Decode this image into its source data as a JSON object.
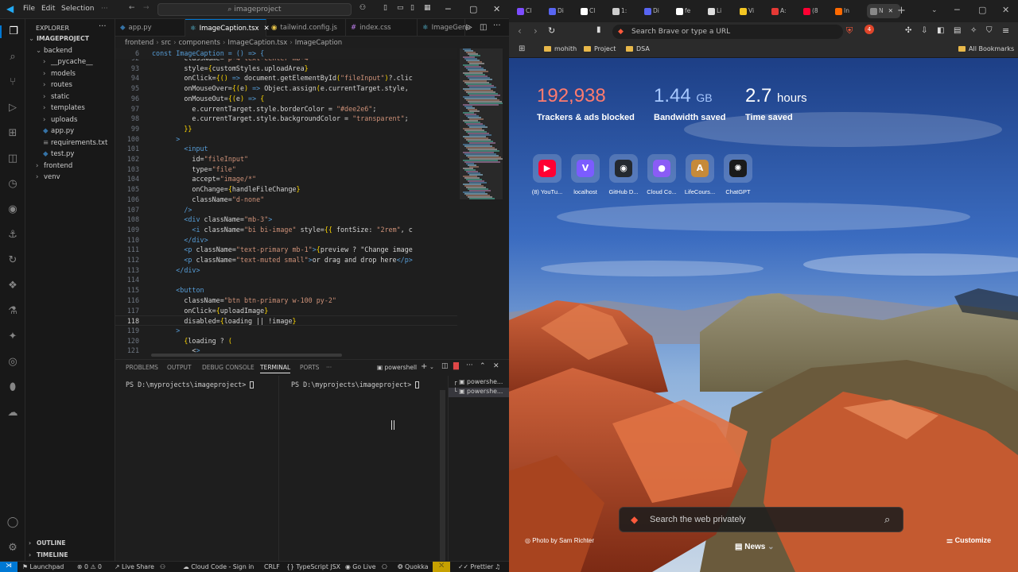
{
  "vscode": {
    "menu": [
      "File",
      "Edit",
      "Selection"
    ],
    "search_text": "imageproject",
    "explorer_title": "EXPLORER",
    "tree": [
      {
        "label": "IMAGEPROJECT",
        "depth": 0,
        "kind": "root"
      },
      {
        "label": "backend",
        "depth": 1,
        "kind": "folder-open"
      },
      {
        "label": "__pycache__",
        "depth": 2,
        "kind": "folder"
      },
      {
        "label": "models",
        "depth": 2,
        "kind": "folder"
      },
      {
        "label": "routes",
        "depth": 2,
        "kind": "folder"
      },
      {
        "label": "static",
        "depth": 2,
        "kind": "folder"
      },
      {
        "label": "templates",
        "depth": 2,
        "kind": "folder"
      },
      {
        "label": "uploads",
        "depth": 2,
        "kind": "folder"
      },
      {
        "label": "app.py",
        "depth": 2,
        "kind": "py"
      },
      {
        "label": "requirements.txt",
        "depth": 2,
        "kind": "txt"
      },
      {
        "label": "test.py",
        "depth": 2,
        "kind": "py"
      },
      {
        "label": "frontend",
        "depth": 1,
        "kind": "folder"
      },
      {
        "label": "venv",
        "depth": 1,
        "kind": "folder"
      }
    ],
    "outline_label": "OUTLINE",
    "timeline_label": "TIMELINE",
    "tabs": [
      {
        "label": "app.py",
        "active": false
      },
      {
        "label": "ImageCaption.tsx",
        "active": true
      },
      {
        "label": "tailwind.config.js",
        "active": false
      },
      {
        "label": "index.css",
        "active": false
      },
      {
        "label": "ImageGene",
        "active": false
      }
    ],
    "breadcrumb": [
      "frontend",
      "src",
      "components",
      "ImageCaption.tsx",
      "ImageCaption"
    ],
    "sticky_line": {
      "num": "6",
      "text": "const ImageCaption = () => {"
    },
    "code": [
      {
        "num": "92",
        "text": "        className=\"p-4 text-center mb-4\""
      },
      {
        "num": "93",
        "text": "        style={customStyles.uploadArea}"
      },
      {
        "num": "94",
        "text": "        onClick={() => document.getElementById(\"fileInput\")?.clic"
      },
      {
        "num": "95",
        "text": "        onMouseOver={(e) => Object.assign(e.currentTarget.style,"
      },
      {
        "num": "96",
        "text": "        onMouseOut={(e) => {"
      },
      {
        "num": "97",
        "text": "          e.currentTarget.style.borderColor = \"#dee2e6\";"
      },
      {
        "num": "98",
        "text": "          e.currentTarget.style.backgroundColor = \"transparent\";"
      },
      {
        "num": "99",
        "text": "        }}"
      },
      {
        "num": "100",
        "text": "      >"
      },
      {
        "num": "101",
        "text": "        <input"
      },
      {
        "num": "102",
        "text": "          id=\"fileInput\""
      },
      {
        "num": "103",
        "text": "          type=\"file\""
      },
      {
        "num": "104",
        "text": "          accept=\"image/*\""
      },
      {
        "num": "105",
        "text": "          onChange={handleFileChange}"
      },
      {
        "num": "106",
        "text": "          className=\"d-none\""
      },
      {
        "num": "107",
        "text": "        />"
      },
      {
        "num": "108",
        "text": "        <div className=\"mb-3\">"
      },
      {
        "num": "109",
        "text": "          <i className=\"bi bi-image\" style={{ fontSize: \"2rem\", c"
      },
      {
        "num": "110",
        "text": "        </div>"
      },
      {
        "num": "111",
        "text": "        <p className=\"text-primary mb-1\">{preview ? \"Change image"
      },
      {
        "num": "112",
        "text": "        <p className=\"text-muted small\">or drag and drop here</p>"
      },
      {
        "num": "113",
        "text": "      </div>"
      },
      {
        "num": "114",
        "text": ""
      },
      {
        "num": "115",
        "text": "      <button"
      },
      {
        "num": "116",
        "text": "        className=\"btn btn-primary w-100 py-2\""
      },
      {
        "num": "117",
        "text": "        onClick={uploadImage}"
      },
      {
        "num": "118",
        "text": "        disabled={loading || !image}"
      },
      {
        "num": "119",
        "text": "      >"
      },
      {
        "num": "120",
        "text": "        {loading ? ("
      },
      {
        "num": "121",
        "text": "          <>"
      }
    ],
    "current_line": "118",
    "panel_tabs": [
      "PROBLEMS",
      "OUTPUT",
      "DEBUG CONSOLE",
      "TERMINAL",
      "PORTS"
    ],
    "active_panel_tab": "TERMINAL",
    "terminal_shell": "powershell",
    "terminal_prompt_left": "PS D:\\myprojects\\imageproject> ",
    "terminal_prompt_right": "PS D:\\myprojects\\imageproject> ",
    "terminal_list": [
      "powershe...",
      "powershe..."
    ],
    "status": {
      "launchpad": "Launchpad",
      "errors": "0",
      "warnings": "0",
      "live_share": "Live Share",
      "cloud_code": "Cloud Code - Sign in",
      "eol": "CRLF",
      "language": "TypeScript JSX",
      "go_live": "Go Live",
      "quokka": "Quokka",
      "prettier": "Prettier"
    }
  },
  "browser": {
    "tabs": [
      {
        "label": "Cl",
        "color": "#7d4dff"
      },
      {
        "label": "Di",
        "color": "#5865f2"
      },
      {
        "label": "Cl",
        "color": "#ffffff"
      },
      {
        "label": "1:",
        "color": "#cccccc"
      },
      {
        "label": "Di",
        "color": "#5865f2"
      },
      {
        "label": "fe",
        "color": "#ffffff"
      },
      {
        "label": "Li",
        "color": "#dddddd"
      },
      {
        "label": "Vi",
        "color": "#f3c623"
      },
      {
        "label": "A:",
        "color": "#e53935"
      },
      {
        "label": "(8",
        "color": "#ff0033"
      },
      {
        "label": "In",
        "color": "#ff6a00"
      },
      {
        "label": "N",
        "color": "#888888"
      }
    ],
    "url_placeholder": "Search Brave or type a URL",
    "shield_count": "4",
    "bookmarks": [
      "mohith",
      "Project",
      "DSA"
    ],
    "all_bookmarks": "All Bookmarks",
    "stats": [
      {
        "value": "192,938",
        "unit": "",
        "label": "Trackers & ads blocked",
        "color": "#ff7b6e"
      },
      {
        "value": "1.44",
        "unit": "GB",
        "label": "Bandwidth saved",
        "color": "#a7c8ff"
      },
      {
        "value": "2.7",
        "unit": "hours",
        "label": "Time saved",
        "color": "#ffffff"
      }
    ],
    "top_sites": [
      {
        "label": "(8) YouTu...",
        "icon": "youtube-icon",
        "bg": "#ff0033",
        "glyph": "▶"
      },
      {
        "label": "localhost",
        "icon": "vite-icon",
        "bg": "#7b5cff",
        "glyph": "V"
      },
      {
        "label": "GitHub D...",
        "icon": "github-icon",
        "bg": "#24292f",
        "glyph": "◉"
      },
      {
        "label": "Cloud Co...",
        "icon": "cloud-code-icon",
        "bg": "#8a5cf6",
        "glyph": "●"
      },
      {
        "label": "LifeCours...",
        "icon": "lifecourse-icon",
        "bg": "#c68a3a",
        "glyph": "A"
      },
      {
        "label": "ChatGPT",
        "icon": "chatgpt-icon",
        "bg": "#1a1a1a",
        "glyph": "✺"
      }
    ],
    "photo_credit": "Photo by Sam Richter",
    "search_placeholder": "Search the web privately",
    "news_label": "News",
    "customize_label": "Customize"
  }
}
